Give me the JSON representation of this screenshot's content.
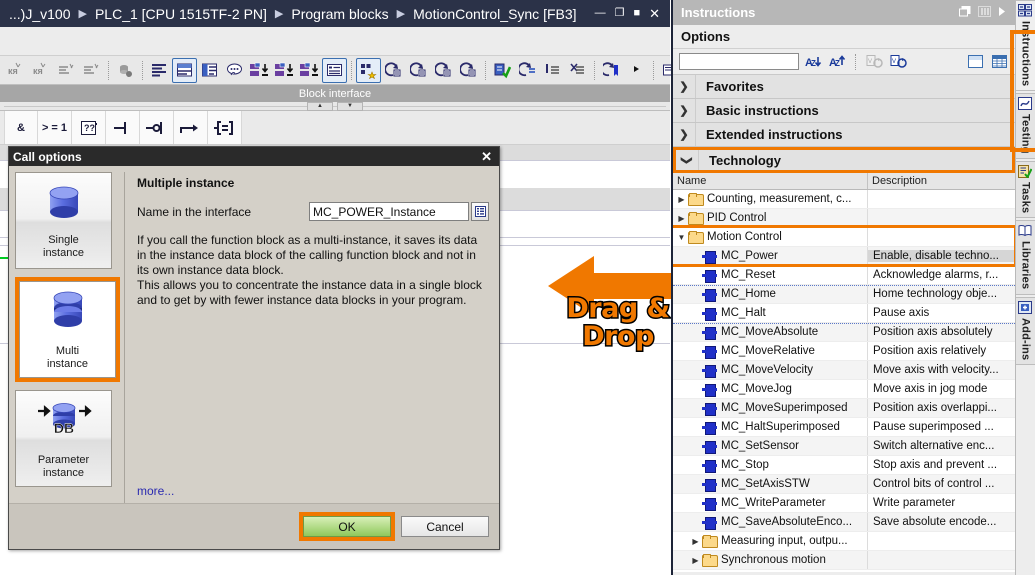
{
  "editor": {
    "breadcrumb": [
      "...)J_v100",
      "PLC_1 [CPU 1515TF-2 PN]",
      "Program blocks",
      "MotionControl_Sync [FB3]"
    ],
    "window_buttons": [
      {
        "name": "minimize",
        "glyph": "—"
      },
      {
        "name": "restore",
        "glyph": "❐"
      },
      {
        "name": "maximize",
        "glyph": "■"
      },
      {
        "name": "close",
        "glyph": "✕"
      }
    ],
    "block_interface_label": "Block interface",
    "favorites": [
      "&",
      "> = 1",
      "??",
      "⊣",
      "—o|",
      "↦",
      "-[=]"
    ],
    "toolbar_icons": [
      "insert-network-icon",
      "delete-network-icon",
      "collapse-networks-icon",
      "expand-networks-icon",
      "absolute-relative-icon",
      "show-hide-all-icon",
      "comments-on-icon",
      "network-comments-icon",
      "show-comment-icon",
      "show-symbolic-icon",
      "show-absolute-icon",
      "show-symbolic-absolute-icon",
      "favorites-layout-icon",
      "add-to-favorites-icon",
      "update-inconsistent-icon",
      "undo-change-icon",
      "redo-change-icon",
      "compile-block-icon",
      "download-check-icon",
      "monitor-on-icon",
      "modify-operand-icon",
      "disable-monitoring-icon",
      "bookmark-icon",
      "more-arrow-icon",
      "print-preview-icon"
    ]
  },
  "dialog": {
    "title": "Call options",
    "close_glyph": "✕",
    "options": [
      {
        "id": "single",
        "label_line1": "Single",
        "label_line2": "instance",
        "icon": "single-db-cylinder-icon",
        "selected": false
      },
      {
        "id": "multi",
        "label_line1": "Multi",
        "label_line2": "instance",
        "icon": "multi-db-cylinder-icon",
        "selected": true
      },
      {
        "id": "parameter",
        "label_line1": "Parameter",
        "label_line2": "instance",
        "icon": "parameter-db-cylinder-icon",
        "selected": false
      }
    ],
    "heading": "Multiple instance",
    "name_label": "Name in the interface",
    "name_value": "MC_POWER_Instance",
    "name_placeholder": "",
    "description": "If you call the function block as a multi-instance, it saves its data in the instance data block of the calling function block and not in its own instance data block.\nThis allows you to concentrate the instance data in a single block and to get by with fewer instance data blocks in your program.",
    "more_link": "more...",
    "ok_label": "OK",
    "cancel_label": "Cancel"
  },
  "annotation": {
    "drag_line1": "Drag &",
    "drag_line2": "Drop",
    "color": "#F07800"
  },
  "instructions": {
    "title": "Instructions",
    "title_actions": [
      "float-pane-icon",
      "split-pane-icon",
      "collapse-pane-icon"
    ],
    "options_label": "Options",
    "search_value": "",
    "search_placeholder": "",
    "option_icons": [
      "sort-descending-icon",
      "sort-ascending-icon",
      "filter-version-icon",
      "set-version-icon",
      "tree-view-icon",
      "table-view-icon"
    ],
    "accordions": [
      {
        "label": "Favorites",
        "expanded": false,
        "highlighted": false
      },
      {
        "label": "Basic instructions",
        "expanded": false,
        "highlighted": false
      },
      {
        "label": "Extended instructions",
        "expanded": false,
        "highlighted": false
      },
      {
        "label": "Technology",
        "expanded": true,
        "highlighted": true
      }
    ],
    "columns": [
      "Name",
      "Description"
    ],
    "rows": [
      {
        "name": "Counting, measurement, c...",
        "desc": "",
        "kind": "folder",
        "indent": 0,
        "expanded": false
      },
      {
        "name": "PID Control",
        "desc": "",
        "kind": "folder",
        "indent": 0,
        "expanded": false
      },
      {
        "name": "Motion Control",
        "desc": "",
        "kind": "folder",
        "indent": 0,
        "expanded": true,
        "highlighted": true
      },
      {
        "name": "MC_Power",
        "desc": "Enable, disable techno...",
        "kind": "fb",
        "indent": 1,
        "highlighted": true
      },
      {
        "name": "MC_Reset",
        "desc": "Acknowledge alarms, r...",
        "kind": "fb",
        "indent": 1
      },
      {
        "name": "MC_Home",
        "desc": "Home technology obje...",
        "kind": "fb",
        "indent": 1
      },
      {
        "name": "MC_Halt",
        "desc": "Pause axis",
        "kind": "fb",
        "indent": 1
      },
      {
        "name": "MC_MoveAbsolute",
        "desc": "Position axis absolutely",
        "kind": "fb",
        "indent": 1
      },
      {
        "name": "MC_MoveRelative",
        "desc": "Position axis relatively",
        "kind": "fb",
        "indent": 1
      },
      {
        "name": "MC_MoveVelocity",
        "desc": "Move axis with velocity...",
        "kind": "fb",
        "indent": 1
      },
      {
        "name": "MC_MoveJog",
        "desc": "Move axis in jog mode",
        "kind": "fb",
        "indent": 1
      },
      {
        "name": "MC_MoveSuperimposed",
        "desc": "Position axis overlappi...",
        "kind": "fb",
        "indent": 1
      },
      {
        "name": "MC_HaltSuperimposed",
        "desc": "Pause superimposed ...",
        "kind": "fb",
        "indent": 1
      },
      {
        "name": "MC_SetSensor",
        "desc": "Switch alternative enc...",
        "kind": "fb",
        "indent": 1
      },
      {
        "name": "MC_Stop",
        "desc": "Stop axis and prevent ...",
        "kind": "fb",
        "indent": 1
      },
      {
        "name": "MC_SetAxisSTW",
        "desc": "Control bits of control ...",
        "kind": "fb",
        "indent": 1
      },
      {
        "name": "MC_WriteParameter",
        "desc": "Write parameter",
        "kind": "fb",
        "indent": 1
      },
      {
        "name": "MC_SaveAbsoluteEnco...",
        "desc": "Save absolute encode...",
        "kind": "fb",
        "indent": 1
      },
      {
        "name": "Measuring input, outpu...",
        "desc": "",
        "kind": "folder",
        "indent": 1,
        "expanded": false
      },
      {
        "name": "Synchronous motion",
        "desc": "",
        "kind": "folder",
        "indent": 1,
        "expanded": false
      }
    ]
  },
  "sidetabs": [
    {
      "label": "Instructions",
      "icon": "instructions-icon",
      "active": true
    },
    {
      "label": "Testing",
      "icon": "testing-icon",
      "active": false
    },
    {
      "label": "Tasks",
      "icon": "tasks-icon",
      "active": false
    },
    {
      "label": "Libraries",
      "icon": "libraries-icon",
      "active": false
    },
    {
      "label": "Add-ins",
      "icon": "add-ins-icon",
      "active": false
    }
  ]
}
